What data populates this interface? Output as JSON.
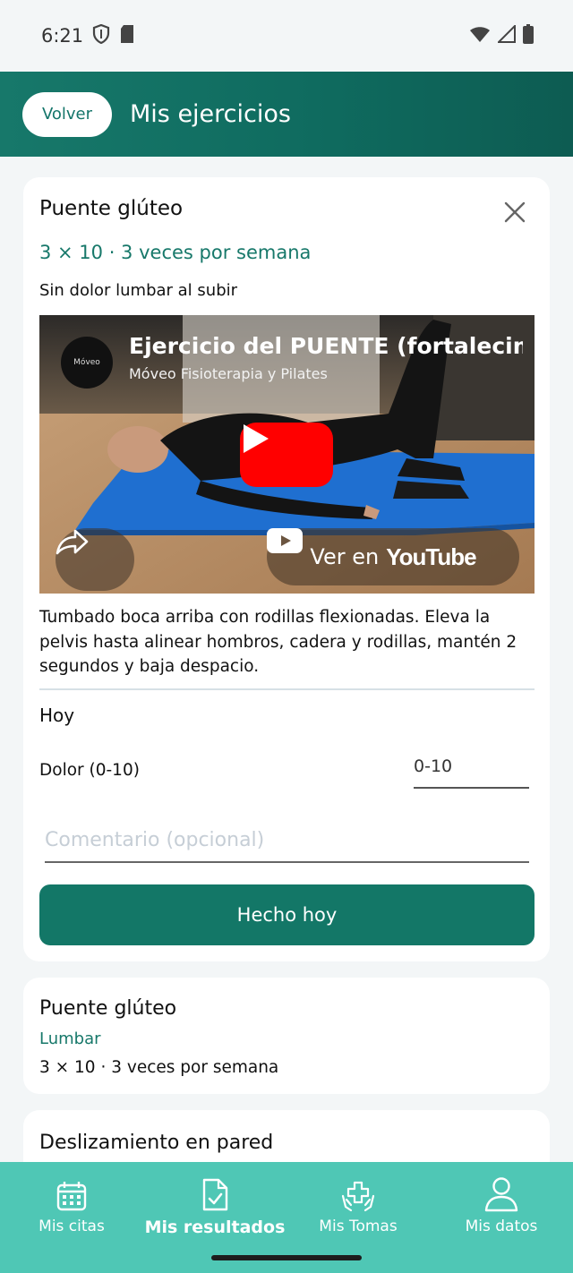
{
  "status_bar": {
    "time": "6:21"
  },
  "header": {
    "back_label": "Volver",
    "title": "Mis ejercicios"
  },
  "exercise_card": {
    "title": "Puente glúteo",
    "dose": "3 × 10 · 3 veces por semana",
    "goal": "Sin dolor lumbar al subir",
    "video": {
      "title": "Ejercicio del PUENTE (fortalecimiento",
      "channel": "Móveo Fisioterapia y Pilates",
      "channel_logo_text": "Móveo",
      "watch_prefix": "Ver en",
      "watch_brand": "YouTube"
    },
    "description": "Tumbado boca arriba con rodillas flexionadas. Eleva la pelvis hasta alinear hombros, cadera y rodillas, mantén 2 segundos y baja despacio.",
    "today_label": "Hoy",
    "pain_label": "Dolor (0-10)",
    "pain_placeholder": "0-10",
    "comment_placeholder": "Comentario (opcional)",
    "done_button": "Hecho hoy"
  },
  "exercise_list": [
    {
      "title": "Puente glúteo",
      "area": "Lumbar",
      "dose": "3 × 10 · 3 veces por semana"
    },
    {
      "title": "Deslizamiento en pared"
    }
  ],
  "bottom_nav": {
    "items": [
      {
        "label": "Mis citas",
        "icon": "calendar-icon"
      },
      {
        "label": "Mis resultados",
        "icon": "clipboard-check-icon",
        "active": true
      },
      {
        "label": "Mis Tomas",
        "icon": "hands-medical-icon"
      },
      {
        "label": "Mis datos",
        "icon": "user-icon"
      }
    ]
  },
  "colors": {
    "primary": "#17786a",
    "nav_background": "#4fc7b5",
    "youtube_red": "#ff0000"
  }
}
